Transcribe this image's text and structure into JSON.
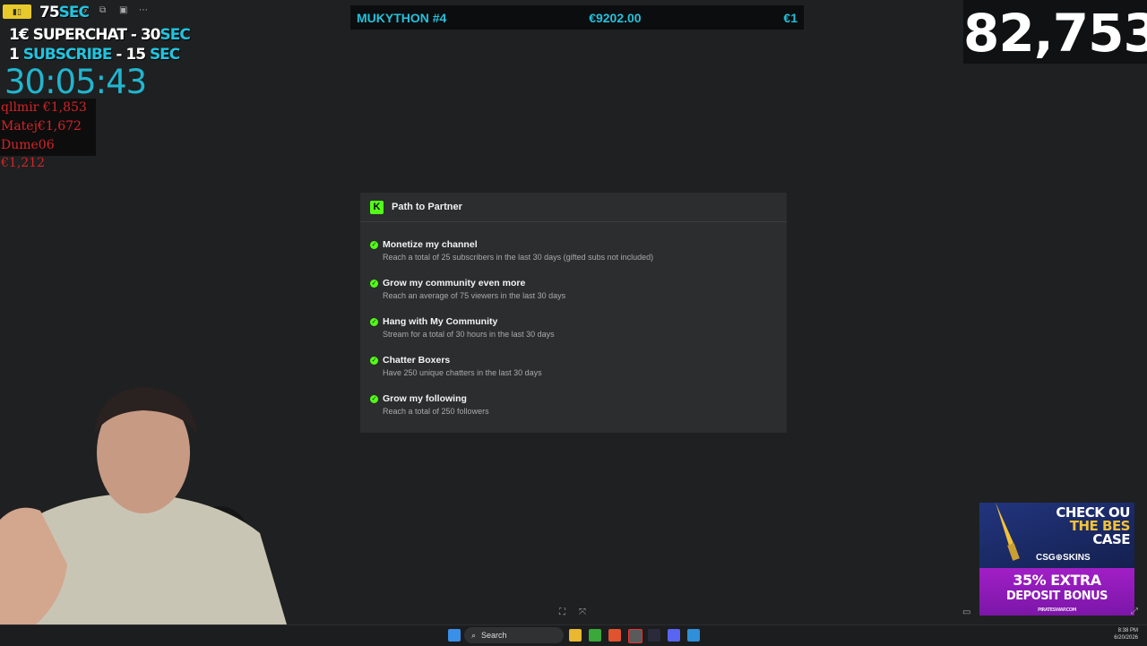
{
  "overlay": {
    "line1_value": "75",
    "line1_unit": "SEC",
    "line2_prefix": "1€ ",
    "line2_word": "SUPERCHAT",
    "line2_value": " - 30",
    "line2_unit": "SEC",
    "line3_prefix": "1 ",
    "line3_word": "SUBSCRIBE",
    "line3_value": " - 15 ",
    "line3_unit": "SEC",
    "timer": "30:05:43",
    "leaders": [
      "qllmir €1,853",
      "Matej€1,672",
      "Dume06 €1,212"
    ]
  },
  "topbar": {
    "title": "MUKYTHON #4",
    "total": "€9202.00",
    "last": "€1"
  },
  "counter": "82,753",
  "panel": {
    "logo_letter": "K",
    "title": "Path to Partner",
    "goals": [
      {
        "title": "Monetize my channel",
        "desc": "Reach a total of 25 subscribers in the last 30 days (gifted subs not included)"
      },
      {
        "title": "Grow my community even more",
        "desc": "Reach an average of 75 viewers in the last 30 days"
      },
      {
        "title": "Hang with My Community",
        "desc": "Stream for a total of 30 hours in the last 30 days"
      },
      {
        "title": "Chatter Boxers",
        "desc": "Have 250 unique chatters in the last 30 days"
      },
      {
        "title": "Grow my following",
        "desc": "Reach a total of 250 followers"
      }
    ]
  },
  "ad": {
    "line1": "CHECK OU",
    "line2": "THE BES",
    "line3": "CASE",
    "brand": "CSG⊕SKINS",
    "promo1": "35% EXTRA",
    "promo2": "DEPOSIT BONUS",
    "footer": "PIRATESWAP.COM"
  },
  "taskbar": {
    "search_label": "Search",
    "time": "8:38 PM",
    "date": "6/20/2026"
  },
  "colors": {
    "accent_cyan": "#21c4e0",
    "kick_green": "#53fc18",
    "leader_red": "#d42428"
  }
}
